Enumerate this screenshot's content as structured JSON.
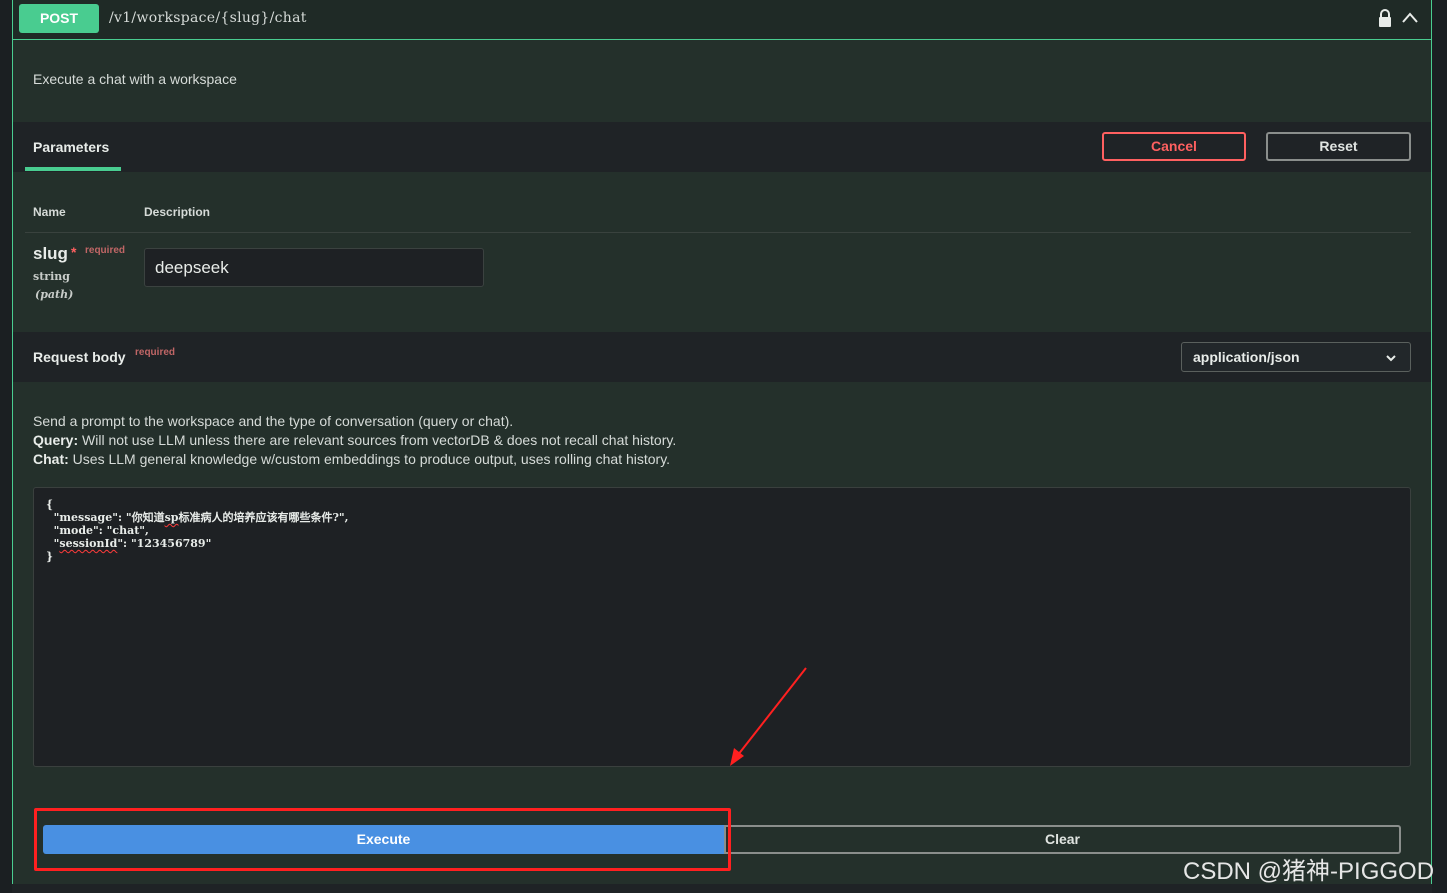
{
  "endpoint": {
    "method": "POST",
    "path": "/v1/workspace/{slug}/chat",
    "description": "Execute a chat with a workspace"
  },
  "parameters_section": {
    "tab_label": "Parameters",
    "cancel_label": "Cancel",
    "reset_label": "Reset",
    "column_name": "Name",
    "column_description": "Description"
  },
  "parameter": {
    "name": "slug",
    "star": "*",
    "required": "required",
    "type": "string",
    "in": "(path)",
    "value": "deepseek"
  },
  "request_body": {
    "title": "Request body",
    "required": "required",
    "content_type": "application/json",
    "intro": "Send a prompt to the workspace and the type of conversation (query or chat).",
    "query_label": "Query:",
    "query_text": " Will not use LLM unless there are relevant sources from vectorDB & does not recall chat history.",
    "chat_label": "Chat:",
    "chat_text": " Uses LLM general knowledge w/custom embeddings to produce output, uses rolling chat history.",
    "code_lines": {
      "l1": "{",
      "l2a": "  \"message\": \"你知道",
      "l2b": "sp",
      "l2c": "标准病人的培养应该有哪些条件?\",",
      "l3": "  \"mode\": \"chat\",",
      "l4a": "  \"",
      "l4b": "sessionId",
      "l4c": "\": \"123456789\"",
      "l5": "}"
    }
  },
  "actions": {
    "execute_label": "Execute",
    "clear_label": "Clear"
  },
  "watermark": "CSDN @猪神-PIGGOD",
  "colors": {
    "post_green": "#49cc90",
    "execute_blue": "#4990e2",
    "cancel_red": "#ff6060",
    "annotation_red": "#ff2020"
  },
  "icons": {
    "lock": "lock-icon",
    "collapse": "chevron-up-icon",
    "dropdown": "chevron-down-icon"
  }
}
